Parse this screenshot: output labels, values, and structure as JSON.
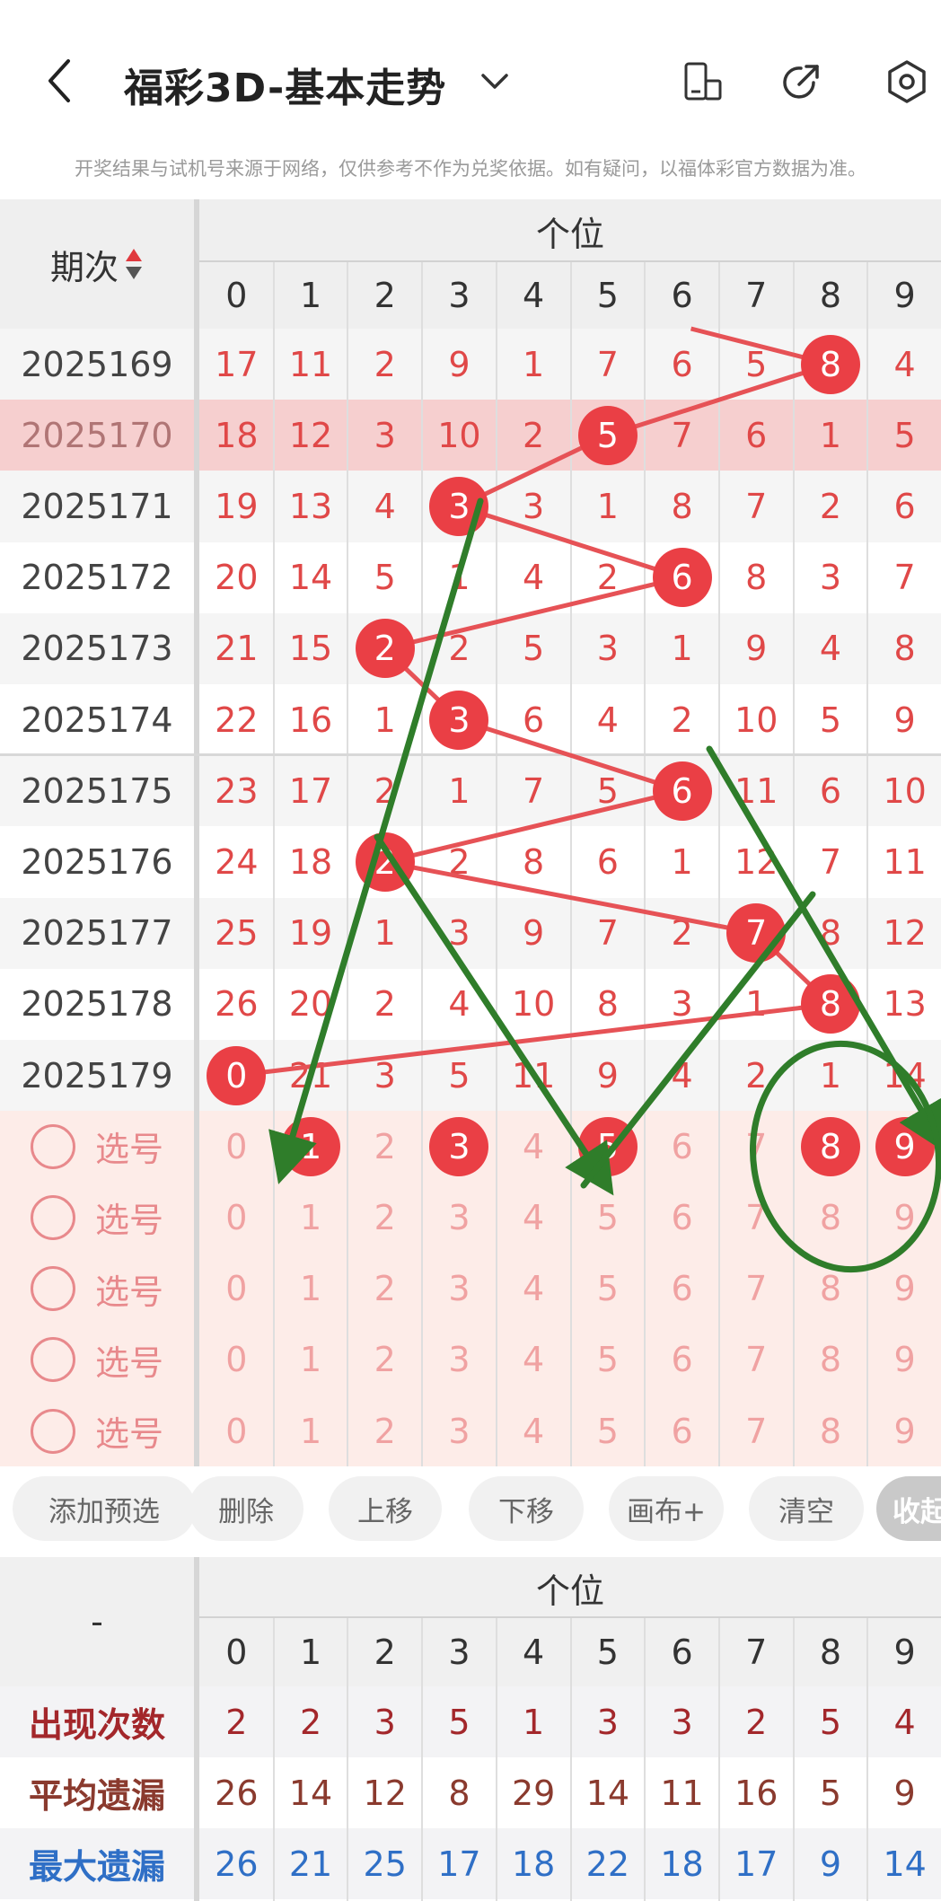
{
  "header": {
    "title": "福彩3D-基本走势",
    "notice": "开奖结果与试机号来源于网络，仅供参考不作为兑奖依据。如有疑问，以福体彩官方数据为准。"
  },
  "table": {
    "group_title": "个位",
    "period_header": "期次",
    "digits": [
      "0",
      "1",
      "2",
      "3",
      "4",
      "5",
      "6",
      "7",
      "8",
      "9"
    ],
    "rows": [
      {
        "period": "2025169",
        "winner": 8,
        "values": [
          "17",
          "11",
          "2",
          "9",
          "1",
          "7",
          "6",
          "5",
          "8",
          "4"
        ]
      },
      {
        "period": "2025170",
        "winner": 5,
        "values": [
          "18",
          "12",
          "3",
          "10",
          "2",
          "5",
          "7",
          "6",
          "1",
          "5"
        ]
      },
      {
        "period": "2025171",
        "winner": 3,
        "values": [
          "19",
          "13",
          "4",
          "3",
          "3",
          "1",
          "8",
          "7",
          "2",
          "6"
        ]
      },
      {
        "period": "2025172",
        "winner": 6,
        "values": [
          "20",
          "14",
          "5",
          "1",
          "4",
          "2",
          "6",
          "8",
          "3",
          "7"
        ]
      },
      {
        "period": "2025173",
        "winner": 2,
        "values": [
          "21",
          "15",
          "2",
          "2",
          "5",
          "3",
          "1",
          "9",
          "4",
          "8"
        ]
      },
      {
        "period": "2025174",
        "winner": 3,
        "values": [
          "22",
          "16",
          "1",
          "3",
          "6",
          "4",
          "2",
          "10",
          "5",
          "9"
        ]
      },
      {
        "period": "2025175",
        "winner": 6,
        "values": [
          "23",
          "17",
          "2",
          "1",
          "7",
          "5",
          "6",
          "11",
          "6",
          "10"
        ]
      },
      {
        "period": "2025176",
        "winner": 2,
        "values": [
          "24",
          "18",
          "2",
          "2",
          "8",
          "6",
          "1",
          "12",
          "7",
          "11"
        ]
      },
      {
        "period": "2025177",
        "winner": 7,
        "values": [
          "25",
          "19",
          "1",
          "3",
          "9",
          "7",
          "2",
          "7",
          "8",
          "12"
        ]
      },
      {
        "period": "2025178",
        "winner": 8,
        "values": [
          "26",
          "20",
          "2",
          "4",
          "10",
          "8",
          "3",
          "1",
          "8",
          "13"
        ]
      },
      {
        "period": "2025179",
        "winner": 0,
        "values": [
          "0",
          "21",
          "3",
          "5",
          "11",
          "9",
          "4",
          "2",
          "1",
          "14"
        ]
      }
    ],
    "select_label": "选号",
    "select_rows": [
      {
        "selected": [
          1,
          3,
          5,
          8,
          9
        ]
      },
      {
        "selected": []
      },
      {
        "selected": []
      },
      {
        "selected": []
      },
      {
        "selected": []
      }
    ]
  },
  "toolbar": {
    "buttons": [
      "添加预选",
      "删除",
      "上移",
      "下移",
      "画布+",
      "清空",
      "收起"
    ]
  },
  "stats": {
    "corner": "-",
    "group_title": "个位",
    "digits": [
      "0",
      "1",
      "2",
      "3",
      "4",
      "5",
      "6",
      "7",
      "8",
      "9"
    ],
    "rows": [
      {
        "label": "出现次数",
        "color": "#a3272b",
        "values": [
          "2",
          "2",
          "3",
          "5",
          "1",
          "3",
          "3",
          "2",
          "5",
          "4"
        ]
      },
      {
        "label": "平均遗漏",
        "color": "#8a3a2e",
        "values": [
          "26",
          "14",
          "12",
          "8",
          "29",
          "14",
          "11",
          "16",
          "5",
          "9"
        ]
      },
      {
        "label": "最大遗漏",
        "color": "#2f6fc6",
        "values": [
          "26",
          "21",
          "25",
          "17",
          "18",
          "22",
          "18",
          "17",
          "9",
          "14"
        ]
      }
    ]
  },
  "colors": {
    "accent_red": "#ea3f45",
    "highlight_row": "#f6cfcf",
    "select_bg": "#fdece8",
    "annotation_green": "#2f7d2a"
  }
}
